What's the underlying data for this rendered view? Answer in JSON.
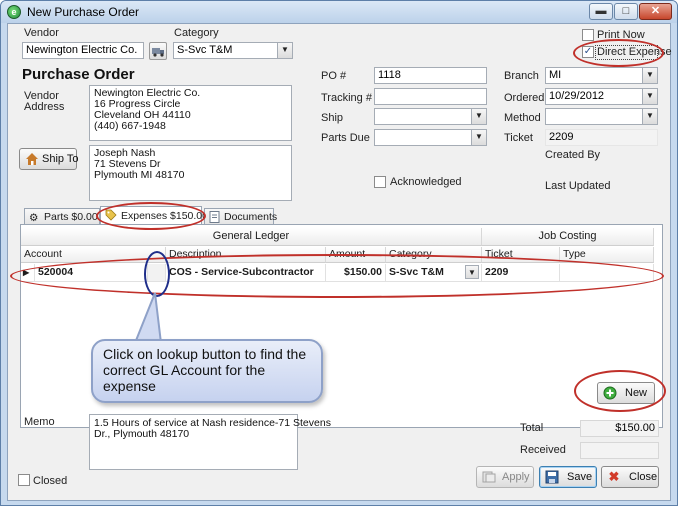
{
  "window": {
    "title": "New Purchase Order",
    "app_icon": "app-logo-icon",
    "controls": {
      "minimize": "▬",
      "maximize": "□",
      "close": "✕"
    }
  },
  "header": {
    "vendor_label": "Vendor",
    "vendor_value": "Newington Electric Co.",
    "category_label": "Category",
    "category_value": "S-Svc T&M",
    "print_now_label": "Print Now",
    "print_now_checked": false,
    "direct_expense_label": "Direct Expense",
    "direct_expense_checked": true
  },
  "form_title": "Purchase Order",
  "vendor_address": {
    "label_line1": "Vendor",
    "label_line2": "Address",
    "lines": [
      "Newington Electric Co.",
      "16 Progress Circle",
      "Cleveland OH 44110",
      "(440) 667-1948"
    ]
  },
  "ship_to": {
    "button_label": "Ship To",
    "lines": [
      "Joseph Nash",
      "71  Stevens Dr",
      "Plymouth MI 48170"
    ]
  },
  "fields": {
    "po_label": "PO #",
    "po_value": "1118",
    "tracking_label": "Tracking #",
    "tracking_value": "",
    "ship_label": "Ship",
    "ship_value": "",
    "parts_due_label": "Parts Due",
    "parts_due_value": "",
    "acknowledged_label": "Acknowledged",
    "branch_label": "Branch",
    "branch_value": "MI",
    "ordered_label": "Ordered",
    "ordered_value": "10/29/2012",
    "method_label": "Method",
    "method_value": "",
    "ticket_label": "Ticket",
    "ticket_value": "2209",
    "created_by_label": "Created By",
    "last_updated_label": "Last Updated"
  },
  "tabs": [
    {
      "label": "Parts $0.00",
      "icon": "gear-icon"
    },
    {
      "label": "Expenses $150.00",
      "icon": "tag-icon"
    },
    {
      "label": "Documents",
      "icon": "document-icon"
    }
  ],
  "grid": {
    "group_headers": {
      "general_ledger": "General Ledger",
      "job_costing": "Job Costing"
    },
    "columns": {
      "account": "Account",
      "description": "Description",
      "amount": "Amount",
      "category": "Category",
      "ticket": "Ticket",
      "type": "Type"
    },
    "row": {
      "account": "520004",
      "description": "COS - Service-Subcontractor",
      "amount": "$150.00",
      "category": "S-Svc T&M",
      "ticket": "2209",
      "type": ""
    }
  },
  "callout": {
    "text": "Click on lookup button to find the correct GL Account for the expense"
  },
  "new_button": {
    "label": "New",
    "icon": "plus-circle-icon"
  },
  "memo": {
    "label": "Memo",
    "lines": [
      "1.5 Hours of service at Nash residence-71 Stevens",
      "Dr., Plymouth 48170"
    ]
  },
  "totals": {
    "total_label": "Total",
    "total_value": "$150.00",
    "received_label": "Received",
    "received_value": ""
  },
  "footer": {
    "closed_label": "Closed",
    "apply_label": "Apply",
    "save_label": "Save",
    "close_label": "Close"
  },
  "colors": {
    "annotation": "#c0302a",
    "lookup_highlight": "#1f2e8a",
    "callout_fill": "#c6d2ef"
  }
}
